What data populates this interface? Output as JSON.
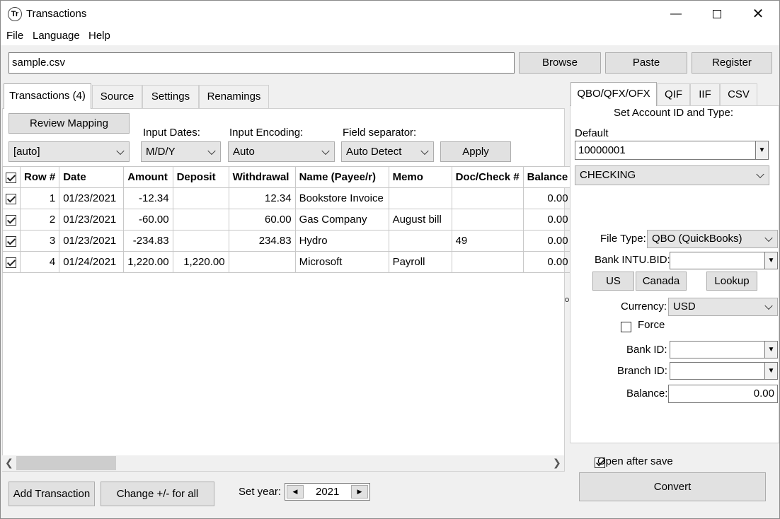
{
  "window": {
    "title": "Transactions",
    "icon_text": "Tr"
  },
  "menu": [
    "File",
    "Language",
    "Help"
  ],
  "file_bar": {
    "path_value": "sample.csv",
    "browse": "Browse",
    "paste": "Paste",
    "register": "Register"
  },
  "left_tabs": [
    "Transactions (4)",
    "Source",
    "Settings",
    "Renamings"
  ],
  "mapping": {
    "review_button": "Review Mapping",
    "mapping_select": "[auto]",
    "input_dates_label": "Input Dates:",
    "input_dates_value": "M/D/Y",
    "input_encoding_label": "Input Encoding:",
    "input_encoding_value": "Auto",
    "field_separator_label": "Field separator:",
    "field_separator_value": "Auto Detect",
    "apply": "Apply"
  },
  "table": {
    "headers": [
      "Row #",
      "Date",
      "Amount",
      "Deposit",
      "Withdrawal",
      "Name (Payee/r)",
      "Memo",
      "Doc/Check #",
      "Balance"
    ],
    "rows": [
      {
        "checked": true,
        "row": "1",
        "date": "01/23/2021",
        "amount": "-12.34",
        "deposit": "",
        "withdrawal": "12.34",
        "name": "Bookstore Invoice",
        "memo": "",
        "doc": "",
        "balance": "0.00"
      },
      {
        "checked": true,
        "row": "2",
        "date": "01/23/2021",
        "amount": "-60.00",
        "deposit": "",
        "withdrawal": "60.00",
        "name": "Gas Company",
        "memo": "August bill",
        "doc": "",
        "balance": "0.00"
      },
      {
        "checked": true,
        "row": "3",
        "date": "01/23/2021",
        "amount": "-234.83",
        "deposit": "",
        "withdrawal": "234.83",
        "name": "Hydro",
        "memo": "",
        "doc": "49",
        "balance": "0.00"
      },
      {
        "checked": true,
        "row": "4",
        "date": "01/24/2021",
        "amount": "1,220.00",
        "deposit": "1,220.00",
        "withdrawal": "",
        "name": "Microsoft",
        "memo": "Payroll",
        "doc": "",
        "balance": "0.00"
      }
    ]
  },
  "bottom_bar": {
    "add_transaction": "Add Transaction",
    "change_sign": "Change +/- for all",
    "set_year_label": "Set year:",
    "year_value": "2021"
  },
  "right_tabs": [
    "QBO/QFX/OFX",
    "QIF",
    "IIF",
    "CSV"
  ],
  "right_panel": {
    "heading": "Set Account ID and Type:",
    "default_label": "Default",
    "account_id_value": "10000001",
    "account_type": "CHECKING",
    "file_type_label": "File Type:",
    "file_type_value": "QBO (QuickBooks)",
    "bank_intu_label": "Bank INTU.BID:",
    "us": "US",
    "canada": "Canada",
    "lookup": "Lookup",
    "currency_label": "Currency:",
    "currency_value": "USD",
    "force_label": "Force",
    "bank_id_label": "Bank ID:",
    "branch_id_label": "Branch ID:",
    "balance_label": "Balance:",
    "balance_value": "0.00"
  },
  "footer_right": {
    "open_after_save": "Open after save",
    "convert": "Convert"
  }
}
